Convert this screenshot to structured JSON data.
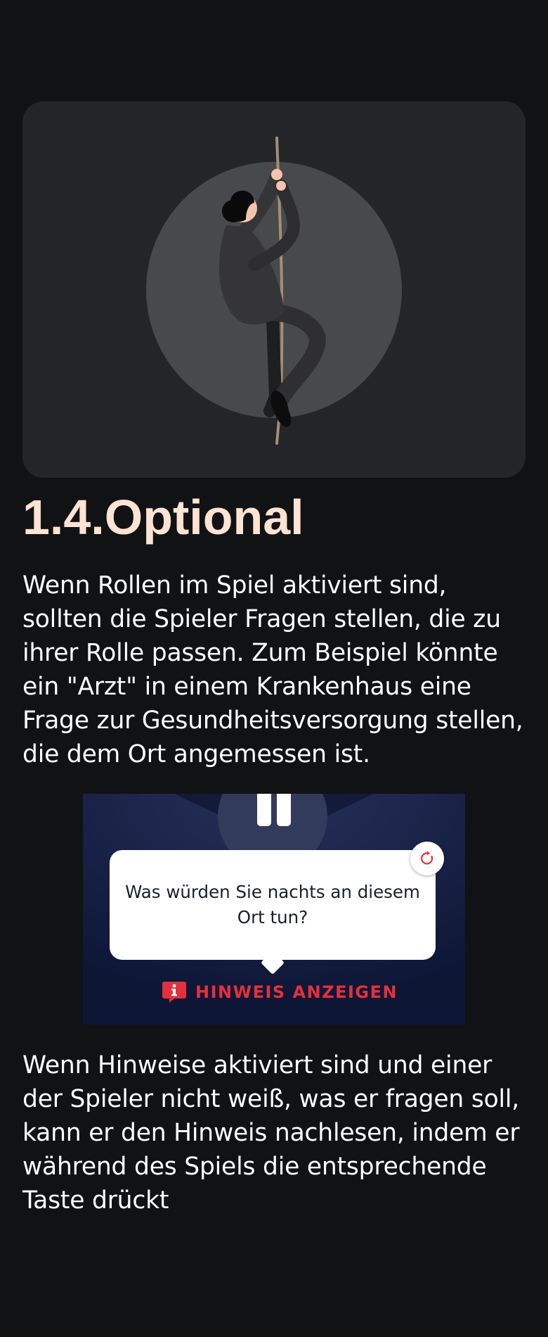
{
  "section": {
    "title": "1.4.Optional",
    "paragraph_1": "Wenn Rollen im Spiel aktiviert sind, sollten die Spieler Fragen stellen, die zu ihrer Rolle passen. Zum Beispiel könnte ein \"Arzt\" in einem Krankenhaus eine Frage zur Gesundheitsversorgung stellen, die dem Ort angemessen ist.",
    "paragraph_2": "Wenn Hinweise aktiviert sind und einer der Spieler nicht weiß, was er fragen soll, kann er den Hinweis nachlesen, indem er während des Spiels die entsprechende Taste drückt"
  },
  "hero": {
    "illustration": "climber-on-rope-illustration"
  },
  "game_preview": {
    "pause_icon": "pause-icon",
    "question": "Was würden Sie nachts an diesem Ort tun?",
    "refresh_icon": "refresh-icon",
    "hint_icon": "info-chat-icon",
    "hint_label": "HINWEIS ANZEIGEN"
  },
  "colors": {
    "background": "#111214",
    "card": "#242528",
    "title_accent": "#fde3d3",
    "hint_red": "#e4303c",
    "panel_navy": "#0e1636"
  }
}
